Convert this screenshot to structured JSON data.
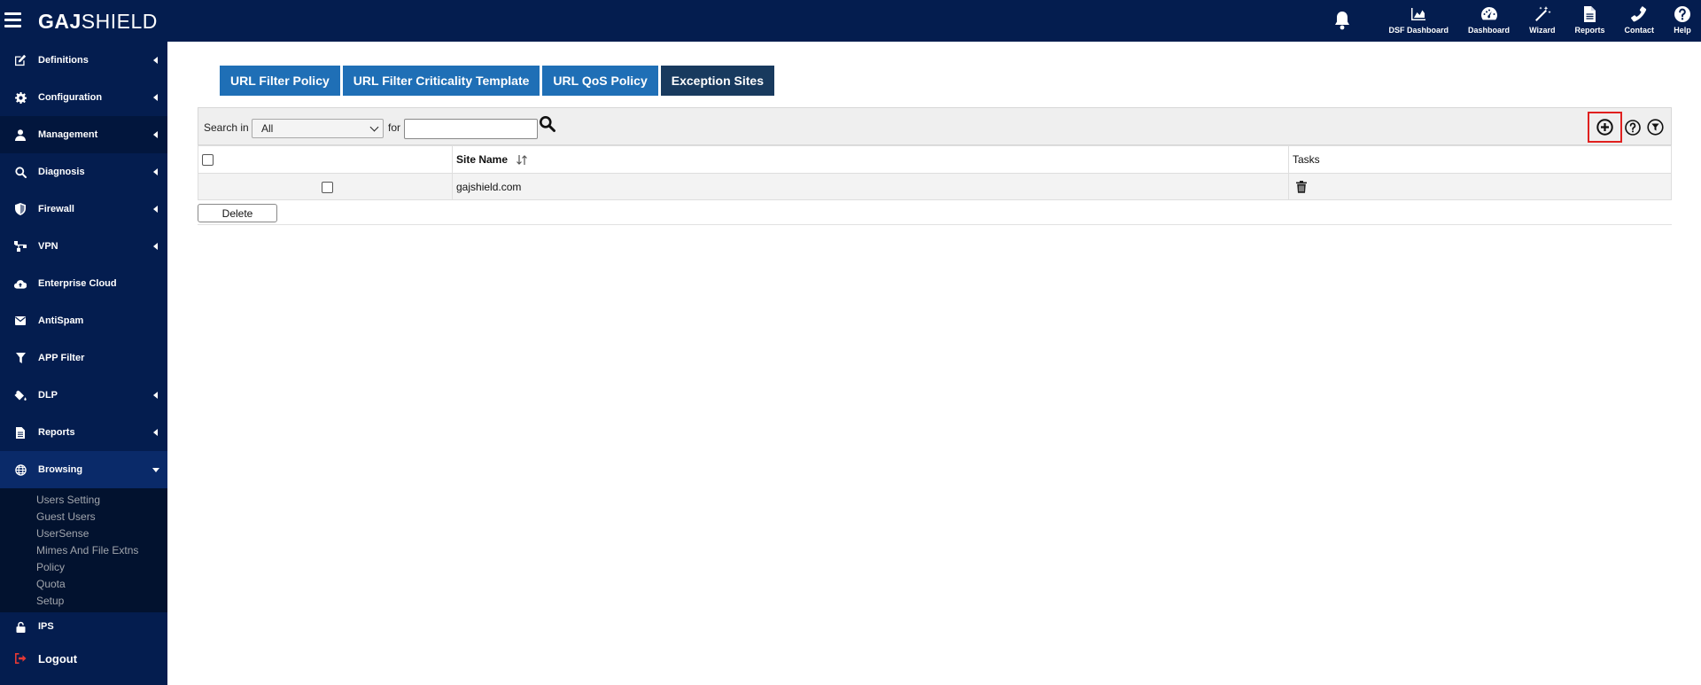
{
  "app": {
    "brand_bold": "GAJ",
    "brand_regular": "SHIELD"
  },
  "topnav": [
    {
      "label": "DSF Dashboard",
      "icon": "area-chart-icon"
    },
    {
      "label": "Dashboard",
      "icon": "speedometer-icon"
    },
    {
      "label": "Wizard",
      "icon": "magic-wand-icon"
    },
    {
      "label": "Reports",
      "icon": "document-icon"
    },
    {
      "label": "Contact",
      "icon": "phone-icon"
    },
    {
      "label": "Help",
      "icon": "question-icon"
    }
  ],
  "sidebar": {
    "items": [
      {
        "label": "Definitions",
        "icon": "edit-icon"
      },
      {
        "label": "Configuration",
        "icon": "gear-icon"
      },
      {
        "label": "Management",
        "icon": "user-icon"
      },
      {
        "label": "Diagnosis",
        "icon": "magnifier-icon"
      },
      {
        "label": "Firewall",
        "icon": "shield-icon"
      },
      {
        "label": "VPN",
        "icon": "network-icon"
      },
      {
        "label": "Enterprise Cloud",
        "icon": "cloud-upload-icon"
      },
      {
        "label": "AntiSpam",
        "icon": "envelope-icon"
      },
      {
        "label": "APP Filter",
        "icon": "funnel-icon"
      },
      {
        "label": "DLP",
        "icon": "paint-bucket-icon"
      },
      {
        "label": "Reports",
        "icon": "file-icon"
      },
      {
        "label": "Browsing",
        "icon": "globe-icon"
      }
    ],
    "browsing_submenu": [
      "Users Setting",
      "Guest Users",
      "UserSense",
      "Mimes And File Extns",
      "Policy",
      "Quota",
      "Setup"
    ],
    "ips": {
      "label": "IPS",
      "icon": "lock-icon"
    },
    "logout": {
      "label": "Logout",
      "icon": "sign-out-icon"
    }
  },
  "tabs": [
    "URL Filter Policy",
    "URL Filter Criticality Template",
    "URL QoS Policy",
    "Exception Sites"
  ],
  "search": {
    "search_in_label": "Search in",
    "selected": "All",
    "for_label": "for",
    "value": ""
  },
  "table": {
    "columns": [
      "Site Name",
      "Tasks"
    ],
    "rows": [
      {
        "site_name": "gajshield.com"
      }
    ]
  },
  "delete_label": "Delete",
  "colors": {
    "nav_bg": "#041d4f",
    "tab_bg": "#1f6fb6",
    "tab_active_bg": "#183a5e",
    "highlight_border": "#e0201f"
  }
}
